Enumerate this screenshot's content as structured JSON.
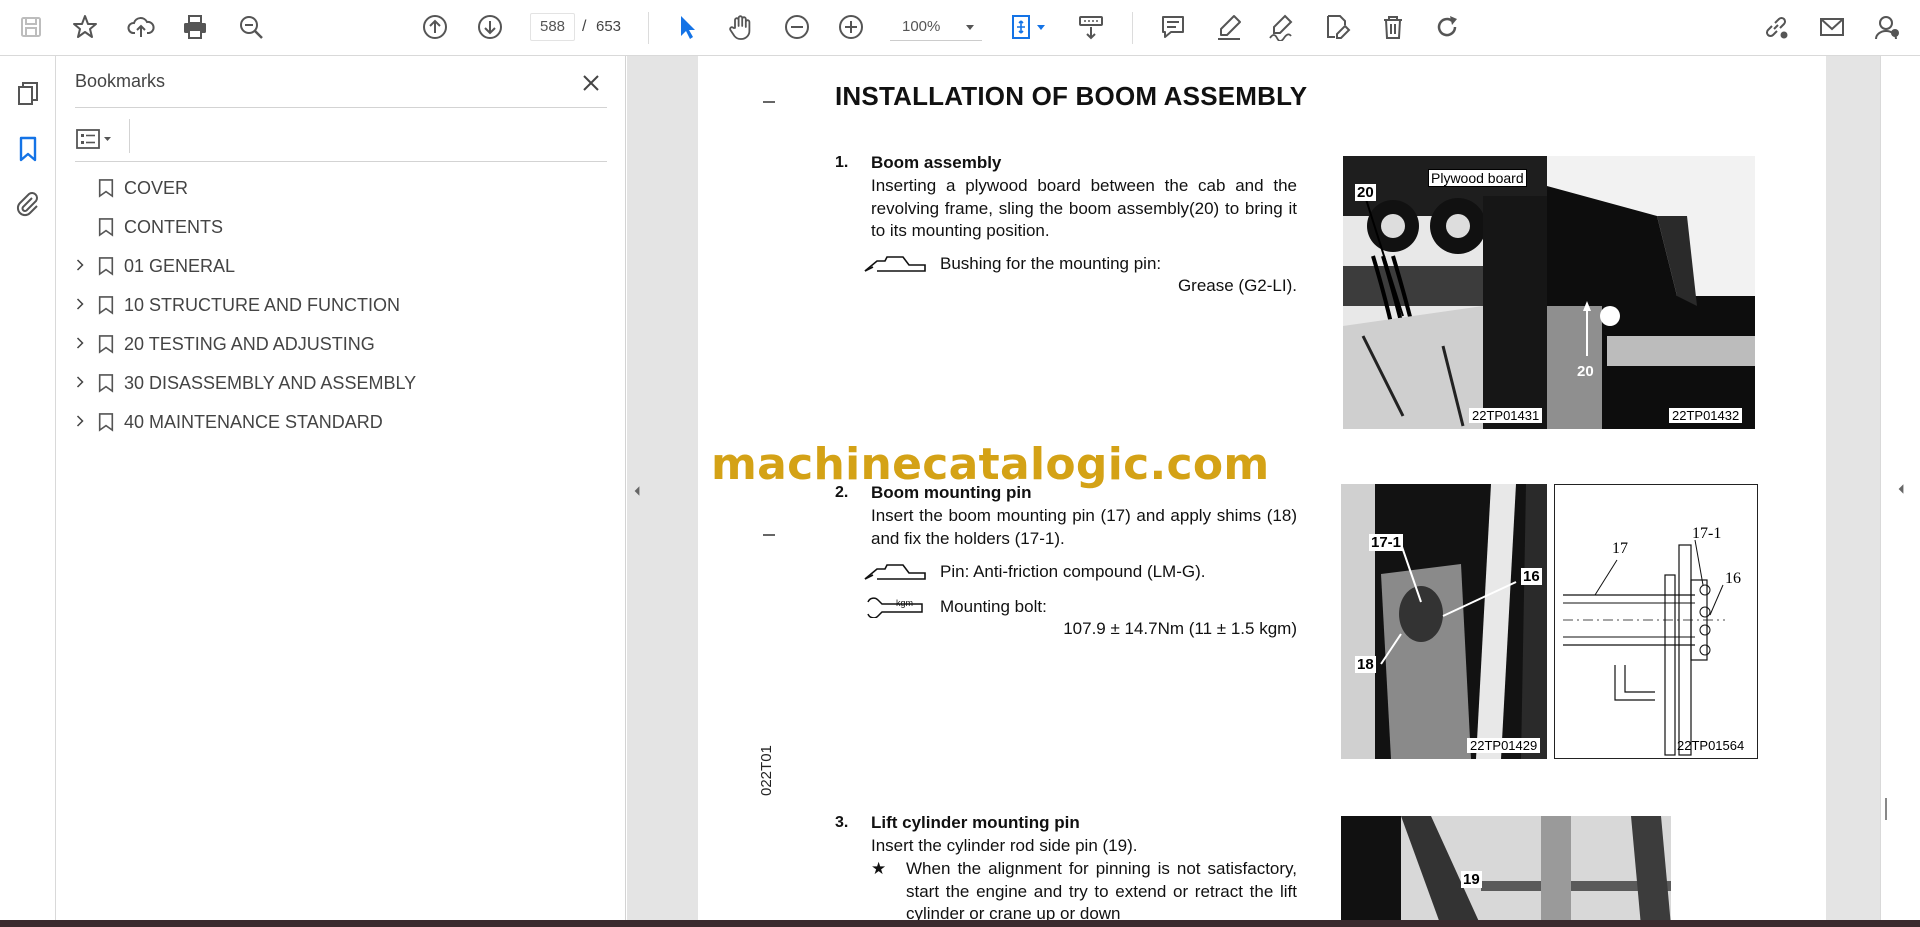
{
  "toolbar": {
    "icons": [
      "save-icon",
      "bookmark-star-icon",
      "upload-icon",
      "print-icon",
      "zoom-search-icon",
      "page-up-icon",
      "page-down-icon",
      "select-arrow-icon",
      "hand-icon",
      "zoom-out-icon",
      "zoom-in-icon",
      "fit-page-icon",
      "scroll-mode-icon",
      "comment-icon",
      "highlight-icon",
      "sign-icon",
      "fill-sign-icon",
      "delete-icon",
      "rotate-icon",
      "share-link-icon",
      "email-icon",
      "account-icon"
    ],
    "page_current": "588",
    "page_separator": "/",
    "page_total": "653",
    "zoom": "100%"
  },
  "bookmarks": {
    "title": "Bookmarks",
    "items": [
      {
        "label": "COVER",
        "expandable": false
      },
      {
        "label": "CONTENTS",
        "expandable": false
      },
      {
        "label": "01 GENERAL",
        "expandable": true
      },
      {
        "label": "10 STRUCTURE AND FUNCTION",
        "expandable": true
      },
      {
        "label": "20 TESTING AND ADJUSTING",
        "expandable": true
      },
      {
        "label": "30 DISASSEMBLY AND ASSEMBLY",
        "expandable": true
      },
      {
        "label": "40 MAINTENANCE STANDARD",
        "expandable": true
      }
    ]
  },
  "document": {
    "title": "INSTALLATION OF BOOM ASSEMBLY",
    "watermark": "machinecatalogic.com",
    "side_code": "022T01",
    "sections": [
      {
        "num": "1.",
        "heading": "Boom assembly",
        "body": "Inserting a plywood board between the cab and the revolving frame, sling the boom assembly(20) to bring it to its mounting position.",
        "grease_label": "Bushing for the mounting pin:",
        "grease_value": "Grease (G2-LI).",
        "photo_left_caption": "22TP01431",
        "photo_right_caption": "22TP01432",
        "callout_plywood": "Plywood board",
        "callout_20a": "20",
        "callout_20b": "20"
      },
      {
        "num": "2.",
        "heading": "Boom mounting pin",
        "body": "Insert the boom mounting pin (17) and apply shims (18) and fix the holders (17-1).",
        "grease_label": "Pin: Anti-friction compound (LM-G).",
        "torque_label": "Mounting bolt:",
        "torque_value": "107.9 ± 14.7Nm (11 ± 1.5 kgm)",
        "torque_symbol_text": "kgm",
        "photo_left_caption": "22TP01429",
        "photo_right_caption": "22TP01564",
        "callout_17_1": "17-1",
        "callout_16": "16",
        "callout_18": "18",
        "diag_17": "17",
        "diag_17_1": "17-1",
        "diag_16": "16"
      },
      {
        "num": "3.",
        "heading": "Lift cylinder mounting pin",
        "body": "Insert the cylinder rod side pin (19).",
        "star": "★",
        "note": "When the alignment for pinning is not satisfactory, start the engine and try to extend or retract the lift cylinder or crane up or down",
        "callout_19": "19"
      }
    ]
  }
}
